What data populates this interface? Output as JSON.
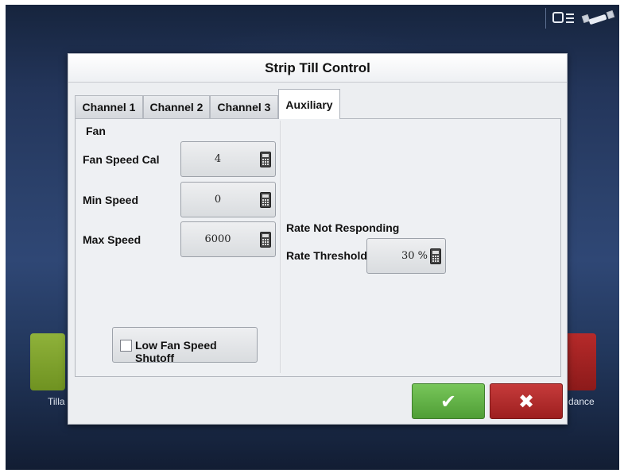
{
  "background": {
    "left_app_label": "Tilla",
    "right_app_label": "dance"
  },
  "dialog": {
    "title": "Strip Till Control",
    "tabs": [
      {
        "label": "Channel 1",
        "active": false
      },
      {
        "label": "Channel 2",
        "active": false
      },
      {
        "label": "Channel 3",
        "active": false
      },
      {
        "label": "Auxiliary",
        "active": true
      }
    ],
    "fan": {
      "section_title": "Fan",
      "fan_speed_cal": {
        "label": "Fan Speed Cal",
        "value": "4"
      },
      "min_speed": {
        "label": "Min Speed",
        "value": "0"
      },
      "max_speed": {
        "label": "Max Speed",
        "value": "6000"
      },
      "low_fan_shutoff": {
        "label": "Low Fan Speed Shutoff",
        "checked": false
      }
    },
    "rate": {
      "section_title": "Rate Not Responding",
      "threshold": {
        "label": "Rate Threshold",
        "value": "30 %"
      }
    },
    "buttons": {
      "ok_glyph": "✔",
      "cancel_glyph": "✖"
    }
  },
  "colors": {
    "ok": "#5cad3f",
    "cancel": "#b02a2a",
    "dialog_bg": "#eceef1"
  },
  "icons": [
    "display-icon",
    "gps-satellite-icon",
    "calculator-icon",
    "checkmark-icon",
    "close-icon"
  ]
}
